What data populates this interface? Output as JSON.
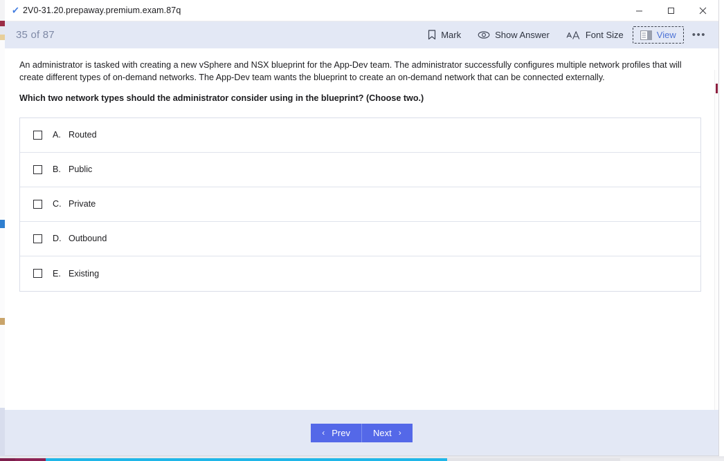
{
  "window": {
    "title": "2V0-31.20.prepaway.premium.exam.87q",
    "app_icon": "blue-checkmark-icon",
    "controls": {
      "minimize": "minimize-icon",
      "maximize": "maximize-icon",
      "close": "close-icon"
    }
  },
  "toolbar": {
    "question_counter": "35 of 87",
    "buttons": [
      {
        "label": "Mark",
        "icon": "bookmark-icon",
        "focused": false
      },
      {
        "label": "Show Answer",
        "icon": "eye-icon",
        "focused": false
      },
      {
        "label": "Font Size",
        "icon": "font-size-icon",
        "focused": false
      },
      {
        "label": "View",
        "icon": "layout-panes-icon",
        "focused": true
      }
    ],
    "overflow_label": "•••"
  },
  "question": {
    "stem": "An administrator is tasked with creating a new vSphere and NSX blueprint for the App-Dev team. The administrator successfully configures multiple network profiles that will create different types of on-demand networks. The App-Dev team wants the blueprint to create an on-demand network that can be connected externally.",
    "prompt": "Which two network types should the administrator consider using in the blueprint? (Choose two.)",
    "options": [
      {
        "letter": "A.",
        "text": "Routed",
        "checked": false
      },
      {
        "letter": "B.",
        "text": "Public",
        "checked": false
      },
      {
        "letter": "C.",
        "text": "Private",
        "checked": false
      },
      {
        "letter": "D.",
        "text": "Outbound",
        "checked": false
      },
      {
        "letter": "E.",
        "text": "Existing",
        "checked": false
      }
    ]
  },
  "footer": {
    "prev_label": "Prev",
    "next_label": "Next",
    "prev_chevron": "‹",
    "next_chevron": "›"
  },
  "colors": {
    "toolbar_band": "#e3e8f5",
    "nav_button": "#5468e8",
    "focus_text": "#4f74d6",
    "counter_text": "#7e89a6",
    "option_border": "#d9dde8"
  }
}
